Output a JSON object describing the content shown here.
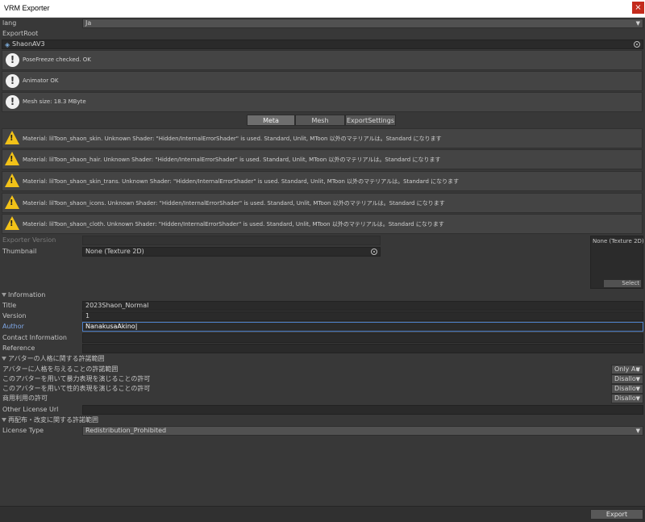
{
  "window": {
    "title": "VRM Exporter",
    "close_glyph": "×"
  },
  "lang": {
    "label": "lang",
    "value": "Ja"
  },
  "export_root": {
    "label": "ExportRoot",
    "value": "ShaonAV3"
  },
  "info_messages": [
    "PoseFreeze checked. OK",
    "Animator OK",
    "Mesh size: 18.3 MByte"
  ],
  "tabs": [
    "Meta",
    "Mesh",
    "ExportSettings"
  ],
  "warnings": [
    "Material: lilToon_shaon_skin. Unknown Shader: \"Hidden/InternalErrorShader\" is used. Standard, Unlit, MToon 以外のマテリアルは。Standard になります",
    "Material: lilToon_shaon_hair. Unknown Shader: \"Hidden/InternalErrorShader\" is used. Standard, Unlit, MToon 以外のマテリアルは。Standard になります",
    "Material: lilToon_shaon_skin_trans. Unknown Shader: \"Hidden/InternalErrorShader\" is used. Standard, Unlit, MToon 以外のマテリアルは。Standard になります",
    "Material: lilToon_shaon_icons. Unknown Shader: \"Hidden/InternalErrorShader\" is used. Standard, Unlit, MToon 以外のマテリアルは。Standard になります",
    "Material: lilToon_shaon_cloth. Unknown Shader: \"Hidden/InternalErrorShader\" is used. Standard, Unlit, MToon 以外のマテリアルは。Standard になります"
  ],
  "meta": {
    "exporter_version_label": "Exporter Version",
    "thumbnail_label": "Thumbnail",
    "thumbnail_value": "None (Texture 2D)",
    "thumbnail_preview_text": "None (Texture 2D)",
    "thumbnail_select": "Select",
    "information_header": "Information",
    "title_label": "Title",
    "title_value": "2023Shaon_Normal",
    "version_label": "Version",
    "version_value": "1",
    "author_label": "Author",
    "author_value": "NanakusaAkino",
    "contact_label": "Contact Information",
    "reference_label": "Reference",
    "permission_header": "アバターの人格に関する許諾範囲",
    "allowed_user_label": "アバターに人格を与えることの許諾範囲",
    "allowed_user_value": "Only Au",
    "violent_label": "このアバターを用いて暴力表現を演じることの許可",
    "violent_value": "Disallov",
    "sexual_label": "このアバターを用いて性的表現を演じることの許可",
    "sexual_value": "Disallov",
    "commercial_label": "商用利用の許可",
    "commercial_value": "Disallov",
    "other_license_label": "Other License Url",
    "redistribution_header": "再配布・改変に関する許諾範囲",
    "license_type_label": "License Type",
    "license_type_value": "Redistribution_Prohibited"
  },
  "footer": {
    "export_label": "Export"
  },
  "colors": {
    "accent_author": "#7fa8e8",
    "warning": "#f2c218",
    "close": "#c42b1c"
  }
}
